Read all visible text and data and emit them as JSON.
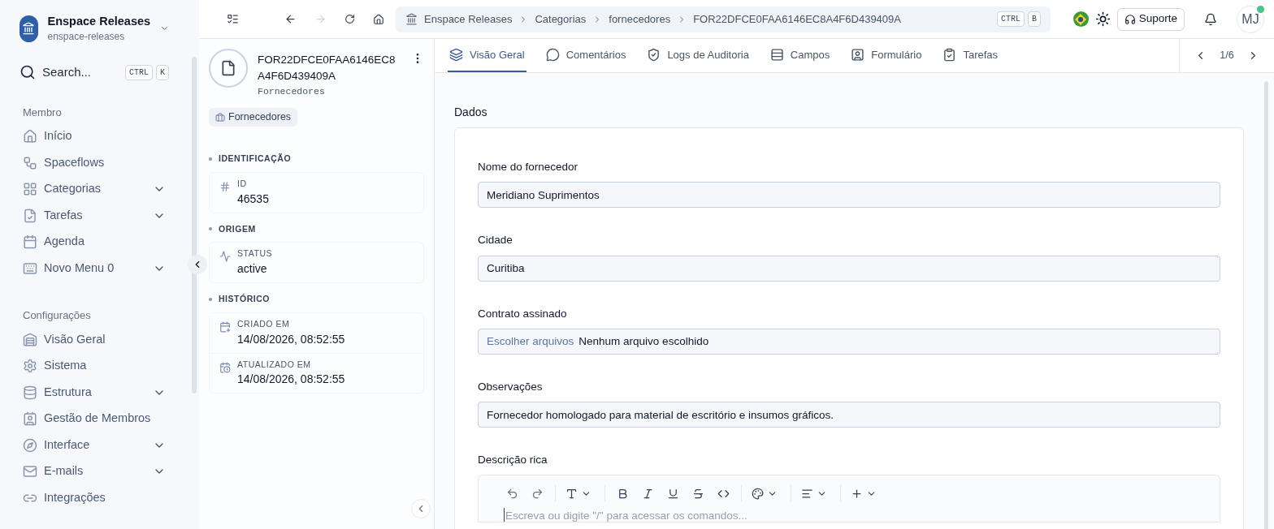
{
  "workspace": {
    "name": "Enspace Releases",
    "slug": "enspace-releases"
  },
  "search": {
    "placeholder": "Search...",
    "keys": [
      "CTRL",
      "K"
    ]
  },
  "sidebar": {
    "sections": [
      {
        "title": "Membro",
        "items": [
          {
            "label": "Início",
            "expandable": false
          },
          {
            "label": "Spaceflows",
            "expandable": false
          },
          {
            "label": "Categorias",
            "expandable": true
          },
          {
            "label": "Tarefas",
            "expandable": true
          },
          {
            "label": "Agenda",
            "expandable": false
          },
          {
            "label": "Novo Menu 0",
            "expandable": true
          }
        ]
      },
      {
        "title": "Configurações",
        "items": [
          {
            "label": "Visão Geral",
            "expandable": false
          },
          {
            "label": "Sistema",
            "expandable": false
          },
          {
            "label": "Estrutura",
            "expandable": true
          },
          {
            "label": "Gestão de Membros",
            "expandable": false
          },
          {
            "label": "Interface",
            "expandable": true
          },
          {
            "label": "E-mails",
            "expandable": true
          },
          {
            "label": "Integrações",
            "expandable": false
          }
        ]
      }
    ]
  },
  "breadcrumb": {
    "items": [
      "Enspace Releases",
      "Categorias",
      "fornecedores",
      "FOR22DFCE0FAA6146EC8A4F6D439409A"
    ],
    "keys": [
      "CTRL",
      "B"
    ]
  },
  "top_actions": {
    "support": "Suporte",
    "avatar": "MJ",
    "online": true
  },
  "record": {
    "title": "FOR22DFCE0FAA6146EC8A4F6D439409A",
    "subtitle": "Fornecedores",
    "tag": "Fornecedores",
    "groups": [
      {
        "title": "IDENTIFICAÇÃO",
        "fields": [
          {
            "label": "ID",
            "value": "46535"
          }
        ]
      },
      {
        "title": "ORIGEM",
        "fields": [
          {
            "label": "STATUS",
            "value": "active"
          }
        ]
      },
      {
        "title": "HISTÓRICO",
        "fields": [
          {
            "label": "CRIADO EM",
            "value": "14/08/2026, 08:52:55"
          },
          {
            "label": "ATUALIZADO EM",
            "value": "14/08/2026, 08:52:55"
          }
        ]
      }
    ]
  },
  "tabs": [
    {
      "label": "Visão Geral",
      "selected": true
    },
    {
      "label": "Comentários",
      "selected": false
    },
    {
      "label": "Logs de Auditoria",
      "selected": false
    },
    {
      "label": "Campos",
      "selected": false
    },
    {
      "label": "Formulário",
      "selected": false
    },
    {
      "label": "Tarefas",
      "selected": false
    }
  ],
  "pager": "1/6",
  "form": {
    "section": "Dados",
    "fields": [
      {
        "kind": "text",
        "label": "Nome do fornecedor",
        "value": "Meridiano Suprimentos"
      },
      {
        "kind": "text",
        "label": "Cidade",
        "value": "Curitiba"
      },
      {
        "kind": "file",
        "label": "Contrato assinado",
        "button": "Escolher arquivos",
        "value": "Nenhum arquivo escolhido"
      },
      {
        "kind": "text",
        "label": "Observações",
        "value": "Fornecedor homologado para material de escritório e insumos gráficos."
      },
      {
        "kind": "rich",
        "label": "Descrição rica",
        "placeholder": "Escreva ou digite \"/\" para acessar os comandos..."
      }
    ]
  }
}
